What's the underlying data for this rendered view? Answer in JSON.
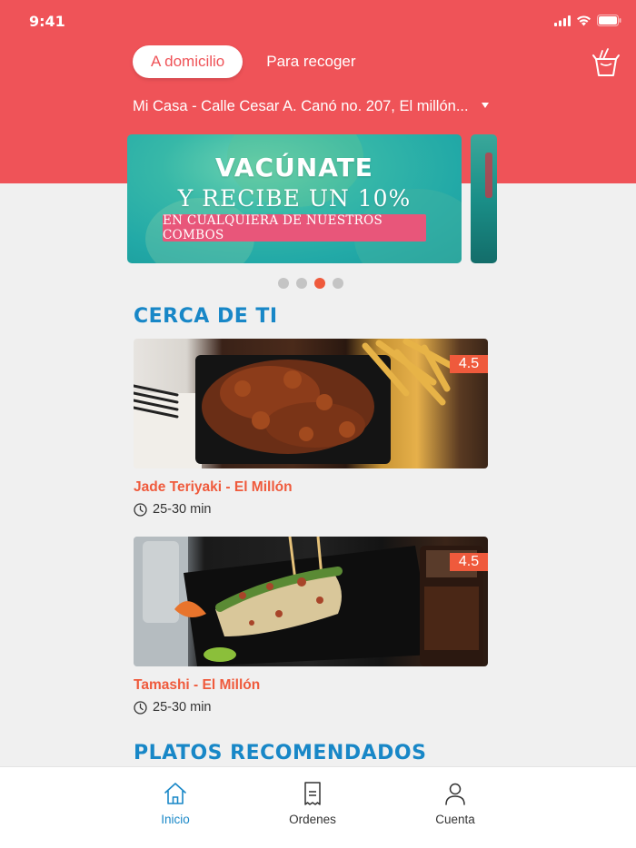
{
  "status_bar": {
    "time": "9:41",
    "icons": [
      "signal-icon",
      "wifi-icon",
      "battery-icon"
    ]
  },
  "header": {
    "tabs": [
      {
        "label": "A domicilio",
        "selected": true
      },
      {
        "label": "Para recoger",
        "selected": false
      }
    ],
    "cart_icon": "takeout-box-icon",
    "address": "Mi Casa - Calle Cesar A. Canó no. 207, El millón..."
  },
  "banner": {
    "title": "VACÚNATE",
    "subtitle": "Y RECIBE UN 10%",
    "pill": "EN CUALQUIERA DE NUESTROS COMBOS",
    "dots_total": 4,
    "dots_active_index": 2
  },
  "sections": {
    "nearby_title": "CERCA DE TI",
    "recommended_title": "PLATOS RECOMENDADOS"
  },
  "restaurants": [
    {
      "name": "Jade Teriyaki - El Millón",
      "rating": "4.5",
      "time": "25-30 min"
    },
    {
      "name": "Tamashi - El Millón",
      "rating": "4.5",
      "time": "25-30 min"
    }
  ],
  "tabbar": {
    "items": [
      {
        "label": "Inicio",
        "icon": "home-icon",
        "active": true
      },
      {
        "label": "Ordenes",
        "icon": "receipt-icon",
        "active": false
      },
      {
        "label": "Cuenta",
        "icon": "user-icon",
        "active": false
      }
    ]
  },
  "colors": {
    "header": "#ef5358",
    "accent": "#ef5a3c",
    "section_title": "#1887c7"
  }
}
